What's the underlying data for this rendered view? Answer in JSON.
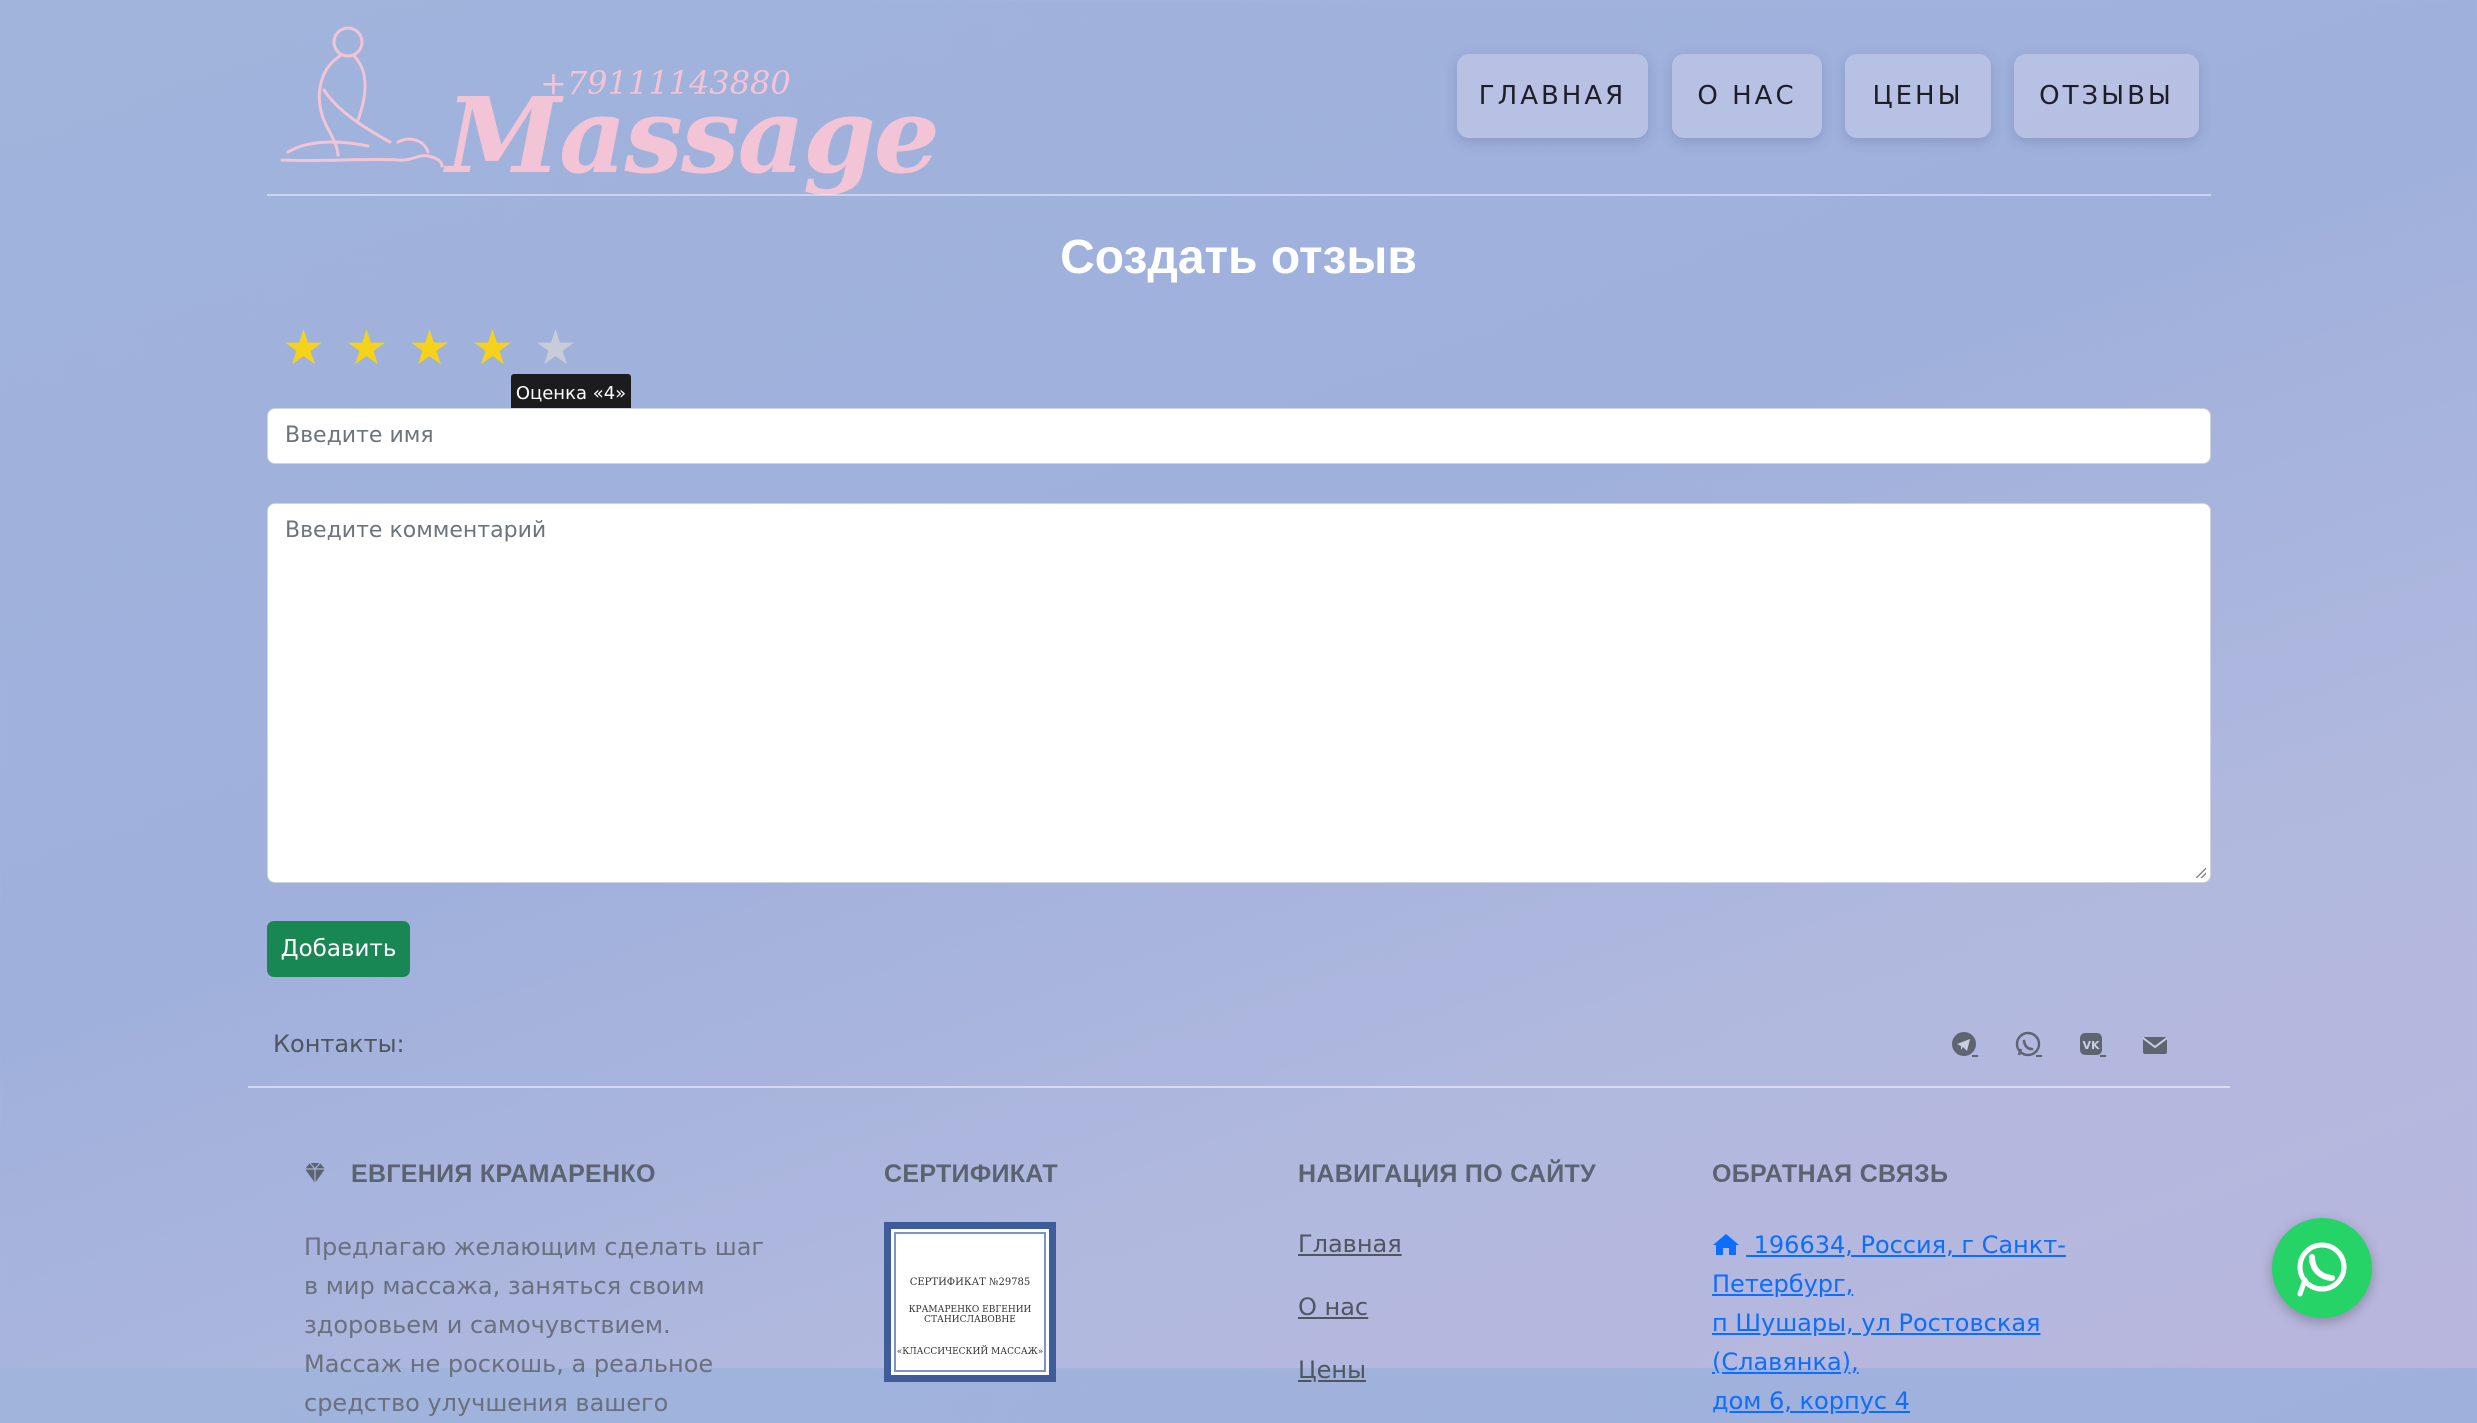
{
  "header": {
    "logo_phone": "+79111143880",
    "logo_word": "Massage",
    "nav": [
      "ГЛАВНАЯ",
      "О НАС",
      "ЦЕНЫ",
      "ОТЗЫВЫ"
    ]
  },
  "review_form": {
    "title": "Создать отзыв",
    "rating": {
      "value": 4,
      "max": 5,
      "tooltip": "Оценка «4»",
      "star_glyph": "★"
    },
    "name_placeholder": "Введите имя",
    "comment_placeholder": "Введите комментарий",
    "submit_label": "Добавить"
  },
  "contacts": {
    "label": "Контакты:",
    "icons": [
      "telegram-icon",
      "whatsapp-icon",
      "vk-icon",
      "envelope-icon"
    ]
  },
  "footer": {
    "about": {
      "heading": "ЕВГЕНИЯ КРАМАРЕНКО",
      "text": "Предлагаю желающим сделать шаг в мир массажа, заняться своим здоровьем и самочувствием. Массаж не роскошь, а реальное средство улучшения вашего"
    },
    "certificate": {
      "heading": "СЕРТИФИКАТ",
      "number": "СЕРТИФИКАТ №29785",
      "holder": "КРАМАРЕНКО ЕВГЕНИИ СТАНИСЛАВОВНЕ",
      "course": "«КЛАССИЧЕСКИЙ МАССАЖ»"
    },
    "navigation": {
      "heading": "НАВИГАЦИЯ ПО САЙТУ",
      "links": [
        "Главная",
        "О нас",
        "Цены"
      ]
    },
    "feedback": {
      "heading": "ОБРАТНАЯ СВЯЗЬ",
      "address_line1": " 196634, Россия, г Санкт-Петербург,",
      "address_line2": "п Шушары, ул Ростовская (Славянка),",
      "address_line3": "дом 6, корпус 4"
    }
  },
  "colors": {
    "accent_green": "#198754",
    "link_blue": "#0d6efd",
    "star_gold": "#f7d21a",
    "whatsapp_green": "#25d366",
    "logo_pink": "#f2c4d6"
  }
}
